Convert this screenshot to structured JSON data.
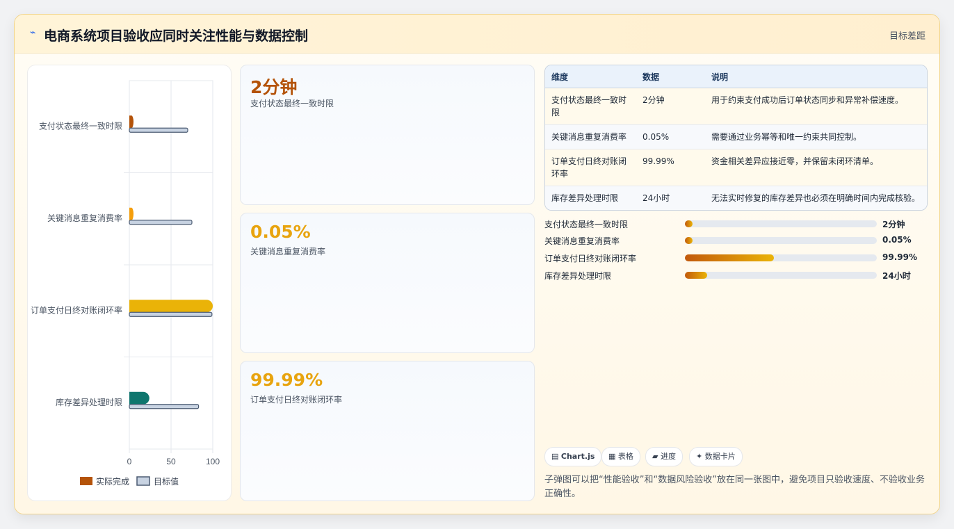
{
  "header": {
    "icon": "chart-icon",
    "title": "电商系统项目验收应同时关注性能与数据控制",
    "tag": "目标差距"
  },
  "chart_data": {
    "type": "bar",
    "orientation": "horizontal",
    "categories": [
      "支付状态最终一致时限",
      "关键消息重复消费率",
      "订单支付日终对账闭环率",
      "库存差异处理时限"
    ],
    "series": [
      {
        "name": "实际完成",
        "values": [
          5,
          5,
          100,
          24
        ],
        "colors": [
          "#b45309",
          "#f59e0b",
          "#eab308",
          "#0f766e"
        ]
      },
      {
        "name": "目标值",
        "values": [
          70,
          75,
          99,
          83
        ],
        "color": "#c8d3e2",
        "stroke": "#4b5b72"
      }
    ],
    "xticks": [
      "0",
      "50",
      "100"
    ],
    "xlim": [
      0,
      100
    ],
    "legend": "bottom",
    "grid": true
  },
  "stats": [
    {
      "value": "2分钟",
      "label": "支付状态最终一致时限",
      "color": "#b45309"
    },
    {
      "value": "0.05%",
      "label": "关键消息重复消费率",
      "color": "#e8a40f"
    },
    {
      "value": "99.99%",
      "label": "订单支付日终对账闭环率",
      "color": "#e8a40f"
    }
  ],
  "table": {
    "headers": [
      "维度",
      "数据",
      "说明"
    ],
    "rows": [
      [
        "支付状态最终一致时限",
        "2分钟",
        "用于约束支付成功后订单状态同步和异常补偿速度。"
      ],
      [
        "关键消息重复消费率",
        "0.05%",
        "需要通过业务幂等和唯一约束共同控制。"
      ],
      [
        "订单支付日终对账闭环率",
        "99.99%",
        "资金相关差异应接近零，并保留未闭环清单。"
      ],
      [
        "库存差异处理时限",
        "24小时",
        "无法实时修复的库存差异也必须在明确时间内完成核验。"
      ]
    ]
  },
  "progress": [
    {
      "label": "支付状态最终一致时限",
      "value": "2分钟",
      "fraction": 0.04
    },
    {
      "label": "关键消息重复消费率",
      "value": "0.05%",
      "fraction": 0.04
    },
    {
      "label": "订单支付日终对账闭环率",
      "value": "99.99%",
      "fraction": 0.465
    },
    {
      "label": "库存差异处理时限",
      "value": "24小时",
      "fraction": 0.115
    }
  ],
  "chips": [
    {
      "icon": "chart-icon",
      "glyph": "▤",
      "label": "Chart.js"
    },
    {
      "icon": "table-icon",
      "glyph": "▦",
      "label": "表格"
    },
    {
      "icon": "progress-icon",
      "glyph": "▰",
      "label": "进度"
    },
    {
      "icon": "card-icon",
      "glyph": "✦",
      "label": "数据卡片"
    }
  ],
  "note": "子弹图可以把“性能验收”和“数据风险验收”放在同一张图中，避免项目只验收速度、不验收业务正确性。"
}
